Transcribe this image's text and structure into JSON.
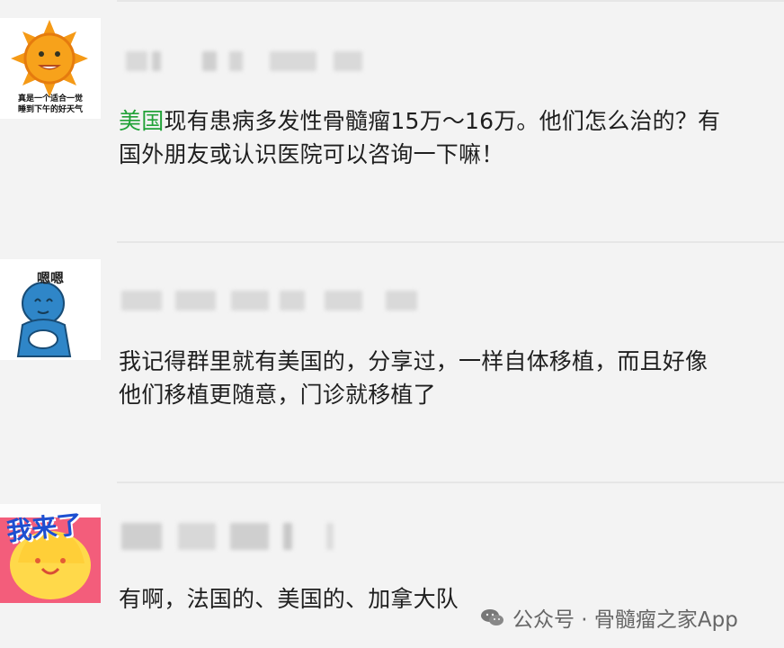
{
  "messages": [
    {
      "avatar_caption_line1": "真是一个适合一觉",
      "avatar_caption_line2": "睡到下午的好天气",
      "highlight": "美国",
      "text": "现有患病多发性骨髓瘤15万～16万。他们怎么治的？有国外朋友或认识医院可以咨询一下嘛！"
    },
    {
      "avatar_text": "嗯嗯",
      "text": "我记得群里就有美国的，分享过，一样自体移植，而且好像他们移植更随意，门诊就移植了"
    },
    {
      "avatar_text": "我来了",
      "text": "有啊，法国的、美国的、加拿大队"
    }
  ],
  "watermark": {
    "text": "公众号 · 骨髓瘤之家App",
    "icon": "wechat-icon"
  },
  "colors": {
    "background": "#f3f3f3",
    "highlight": "#22a238",
    "text": "#1f1f1f",
    "watermark": "#666666"
  }
}
